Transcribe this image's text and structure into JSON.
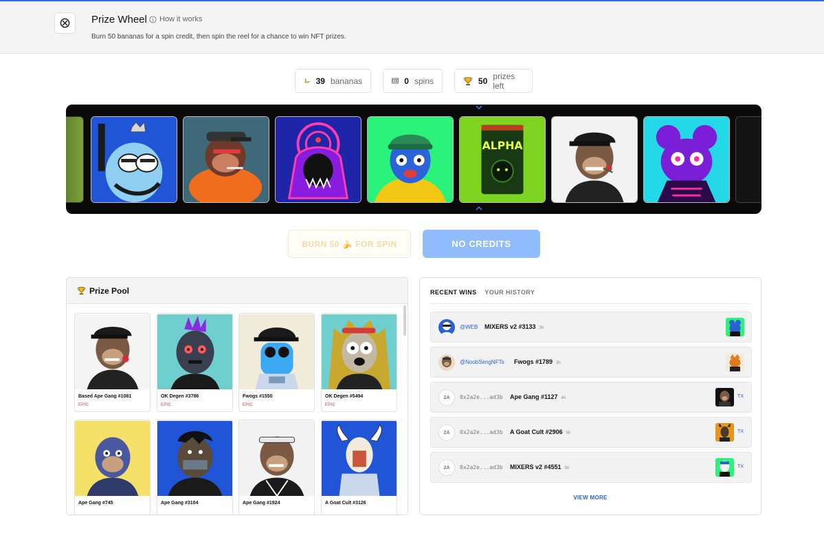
{
  "colors": {
    "accent": "#2f6fe0",
    "link": "#2a62d4",
    "epic": "#e23b3b",
    "reel_bg": "#0a0a0a",
    "no_credits_btn": "#92bdfc"
  },
  "header": {
    "logo_icon": "circle-x-icon",
    "title": "Prize Wheel",
    "how_it_works": "How it works",
    "subtitle": "Burn 50 bananas for a spin credit, then spin the reel for a chance to win NFT prizes."
  },
  "stats": {
    "bananas": {
      "value": "39",
      "label": "bananas",
      "icon": "banana-icon"
    },
    "spins": {
      "value": "0",
      "label": "spins",
      "icon": "slot-icon"
    },
    "prizes": {
      "value": "50",
      "label": "prizes left",
      "icon": "trophy-icon"
    }
  },
  "reel": {
    "items": [
      "penguin-nft",
      "ape-orange-nft",
      "demon-nft",
      "degen-green-nft",
      "alpha-pack-nft",
      "ape-rose-nft",
      "bear-cyan-nft"
    ]
  },
  "actions": {
    "burn_label": "BURN 50 🍌 FOR SPIN",
    "no_credits_label": "NO CREDITS"
  },
  "prize_pool": {
    "title": "Prize Pool",
    "cards": [
      {
        "name": "Based Ape Gang #1081",
        "rarity": "EPIC"
      },
      {
        "name": "OK Degen #3786",
        "rarity": "EPIC"
      },
      {
        "name": "Fwogs #1550",
        "rarity": "EPIC"
      },
      {
        "name": "OK Degen #5494",
        "rarity": "EPIC"
      },
      {
        "name": "Ape Gang #745",
        "rarity": ""
      },
      {
        "name": "Ape Gang #3104",
        "rarity": ""
      },
      {
        "name": "Ape Gang #1924",
        "rarity": ""
      },
      {
        "name": "A Goat Cult #3126",
        "rarity": ""
      }
    ]
  },
  "wins": {
    "tab_recent": "RECENT WINS",
    "tab_history": "YOUR HISTORY",
    "rows": [
      {
        "who": "@WEB",
        "item": "MIXERS v2 #3133",
        "time": "3h",
        "badge": "",
        "tx": ""
      },
      {
        "who": "@NoobSengNFTs",
        "item": "Fwogs #1789",
        "time": "3h",
        "badge": "",
        "tx": ""
      },
      {
        "who": "0x2a2e...ad3b",
        "item": "Ape Gang #1127",
        "time": "4h",
        "badge": "2A",
        "tx": "TX"
      },
      {
        "who": "0x2a2e...ad3b",
        "item": "A Goat Cult #2906",
        "time": "5h",
        "badge": "2A",
        "tx": "TX"
      },
      {
        "who": "0x2a2e...ad3b",
        "item": "MIXERS v2 #4551",
        "time": "5h",
        "badge": "2A",
        "tx": "TX"
      }
    ],
    "view_more": "VIEW MORE"
  }
}
